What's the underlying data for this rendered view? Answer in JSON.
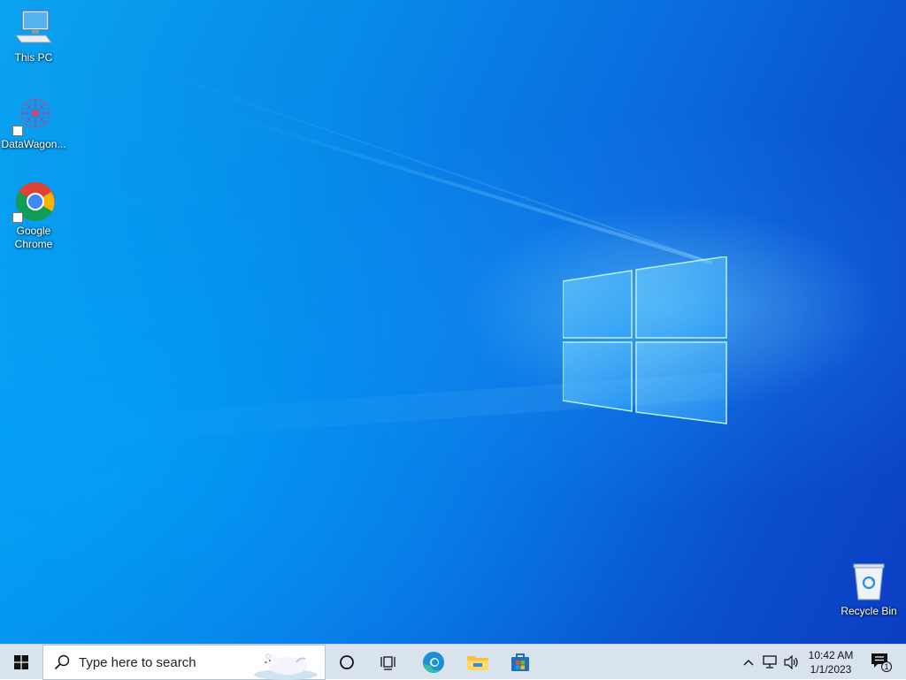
{
  "desktop": {
    "icons": [
      {
        "label": "This PC",
        "icon": "this-pc-icon"
      },
      {
        "label": "DataWagon...",
        "icon": "datawagon-icon"
      },
      {
        "label": "Google Chrome",
        "icon": "chrome-icon"
      },
      {
        "label": "Recycle Bin",
        "icon": "recycle-bin-icon"
      }
    ]
  },
  "taskbar": {
    "search": {
      "placeholder": "Type here to search"
    },
    "pinned": [
      {
        "name": "cortana",
        "icon": "cortana-icon"
      },
      {
        "name": "task-view",
        "icon": "task-view-icon"
      },
      {
        "name": "edge",
        "icon": "edge-icon"
      },
      {
        "name": "file-explorer",
        "icon": "folder-icon"
      },
      {
        "name": "microsoft-store",
        "icon": "store-icon"
      }
    ],
    "tray": {
      "time": "10:42 AM",
      "date": "1/1/2023",
      "notification_count": "1"
    }
  },
  "colors": {
    "taskbar_bg": "#d9e3ee",
    "desktop_accent": "#0a78e6"
  }
}
